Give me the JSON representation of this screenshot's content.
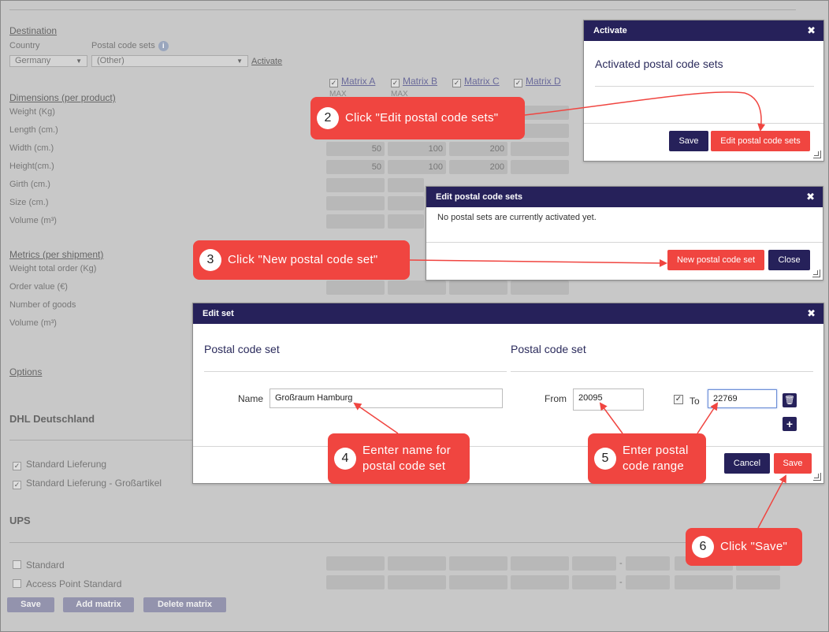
{
  "background": {
    "destination": "Destination",
    "country_label": "Country",
    "country_value": "Germany",
    "postal_label": "Postal code sets",
    "postal_value": "(Other)",
    "activate_link": "Activate",
    "matrices": [
      "Matrix A",
      "Matrix B",
      "Matrix C",
      "Matrix D"
    ],
    "max_label": "MAX",
    "dimensions_title": "Dimensions (per product)",
    "dimension_rows": [
      "Weight (Kg)",
      "Length (cm.)",
      "Width (cm.)",
      "Height(cm.)",
      "Girth (cm.)",
      "Size (cm.)",
      "Volume (m³)"
    ],
    "width_values": [
      "50",
      "100",
      "200"
    ],
    "height_values": [
      "50",
      "100",
      "200"
    ],
    "metrics_title": "Metrics (per shipment)",
    "metric_rows": [
      "Weight total order (Kg)",
      "Order value (€)",
      "Number of goods",
      "Volume (m³)"
    ],
    "options_title": "Options",
    "carrier1": "DHL Deutschland",
    "carrier1_items": [
      "Standard Lieferung",
      "Standard Lieferung - Großartikel"
    ],
    "carrier2": "UPS",
    "carrier2_items": [
      "Standard",
      "Access Point Standard"
    ],
    "dash": "-",
    "buttons": [
      "Save",
      "Add matrix",
      "Delete matrix"
    ]
  },
  "activate_dialog": {
    "title": "Activate",
    "heading": "Activated postal code sets",
    "save": "Save",
    "edit": "Edit postal code sets"
  },
  "edit_sets_dialog": {
    "title": "Edit postal code sets",
    "message": "No postal sets are currently activated yet.",
    "new_set": "New postal code set",
    "close": "Close"
  },
  "edit_set_dialog": {
    "title": "Edit set",
    "left_heading": "Postal code set",
    "right_heading": "Postal code set",
    "name_label": "Name",
    "name_value": "Großraum Hamburg",
    "from_label": "From",
    "from_value": "20095",
    "to_label": "To",
    "to_value": "22769",
    "cancel": "Cancel",
    "save": "Save"
  },
  "callouts": {
    "c2_num": "2",
    "c2_text": "Click \"Edit postal code sets\"",
    "c3_num": "3",
    "c3_text": "Click \"New postal code set\"",
    "c4_num": "4",
    "c4_line1": "Eenter name for",
    "c4_line2": "postal code set",
    "c5_num": "5",
    "c5_line1": "Enter postal",
    "c5_line2": "code range",
    "c6_num": "6",
    "c6_text": "Click \"Save\""
  },
  "colors": {
    "navy": "#26215a",
    "red": "#f04540",
    "overlay": "#c8c8c8"
  }
}
